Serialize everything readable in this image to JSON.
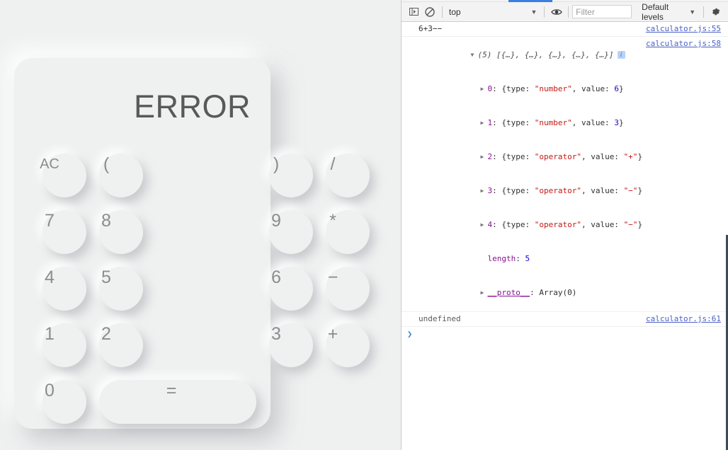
{
  "calculator": {
    "display_value": "ERROR",
    "keys": [
      {
        "label": "AC",
        "name": "key-ac",
        "size": "small"
      },
      {
        "label": "(",
        "name": "key-open-paren",
        "size": "normal"
      },
      {
        "label": ")",
        "name": "key-close-paren",
        "size": "normal"
      },
      {
        "label": "/",
        "name": "key-divide",
        "size": "normal"
      },
      {
        "label": "7",
        "name": "key-7",
        "size": "normal"
      },
      {
        "label": "8",
        "name": "key-8",
        "size": "normal"
      },
      {
        "label": "9",
        "name": "key-9",
        "size": "normal"
      },
      {
        "label": "*",
        "name": "key-multiply",
        "size": "normal"
      },
      {
        "label": "4",
        "name": "key-4",
        "size": "normal"
      },
      {
        "label": "5",
        "name": "key-5",
        "size": "normal"
      },
      {
        "label": "6",
        "name": "key-6",
        "size": "normal"
      },
      {
        "label": "−",
        "name": "key-subtract",
        "size": "normal"
      },
      {
        "label": "1",
        "name": "key-1",
        "size": "normal"
      },
      {
        "label": "2",
        "name": "key-2",
        "size": "normal"
      },
      {
        "label": "3",
        "name": "key-3",
        "size": "normal"
      },
      {
        "label": "+",
        "name": "key-add",
        "size": "normal"
      },
      {
        "label": "0",
        "name": "key-0",
        "size": "normal"
      },
      {
        "label": "=",
        "name": "key-equals",
        "size": "wide"
      }
    ]
  },
  "devtools": {
    "toolbar": {
      "sidebar_icon": "show-console-sidebar-icon",
      "clear_icon": "clear-console-icon",
      "context": "top",
      "context_caret": "▼",
      "eye_icon": "live-expression-eye-icon",
      "filter_placeholder": "Filter",
      "filter_value": "",
      "levels_label": "Default levels",
      "levels_caret": "▼",
      "settings_icon": "gear-icon"
    },
    "accent_blue": "#3b7fe0",
    "messages": [
      {
        "kind": "log",
        "text": "6+3−−",
        "source": "calculator.js:55"
      },
      {
        "kind": "array",
        "summary_count": "(5)",
        "summary_body": "[{…}, {…}, {…}, {…}, {…}]",
        "badge": "i",
        "source": "calculator.js:58",
        "expanded": true,
        "entries": [
          {
            "index": "0",
            "open": "{type: ",
            "type": "\"number\"",
            "mid": ", value: ",
            "value": "6",
            "value_kind": "num",
            "close": "}"
          },
          {
            "index": "1",
            "open": "{type: ",
            "type": "\"number\"",
            "mid": ", value: ",
            "value": "3",
            "value_kind": "num",
            "close": "}"
          },
          {
            "index": "2",
            "open": "{type: ",
            "type": "\"operator\"",
            "mid": ", value: ",
            "value": "\"+\"",
            "value_kind": "str",
            "close": "}"
          },
          {
            "index": "3",
            "open": "{type: ",
            "type": "\"operator\"",
            "mid": ", value: ",
            "value": "\"−\"",
            "value_kind": "str",
            "close": "}"
          },
          {
            "index": "4",
            "open": "{type: ",
            "type": "\"operator\"",
            "mid": ", value: ",
            "value": "\"−\"",
            "value_kind": "str",
            "close": "}"
          }
        ],
        "length_label": "length",
        "length_value": "5",
        "proto_label": "__proto__",
        "proto_value": "Array(0)"
      },
      {
        "kind": "log",
        "text": "undefined",
        "source": "calculator.js:61"
      }
    ],
    "prompt_chevron": "❯"
  }
}
